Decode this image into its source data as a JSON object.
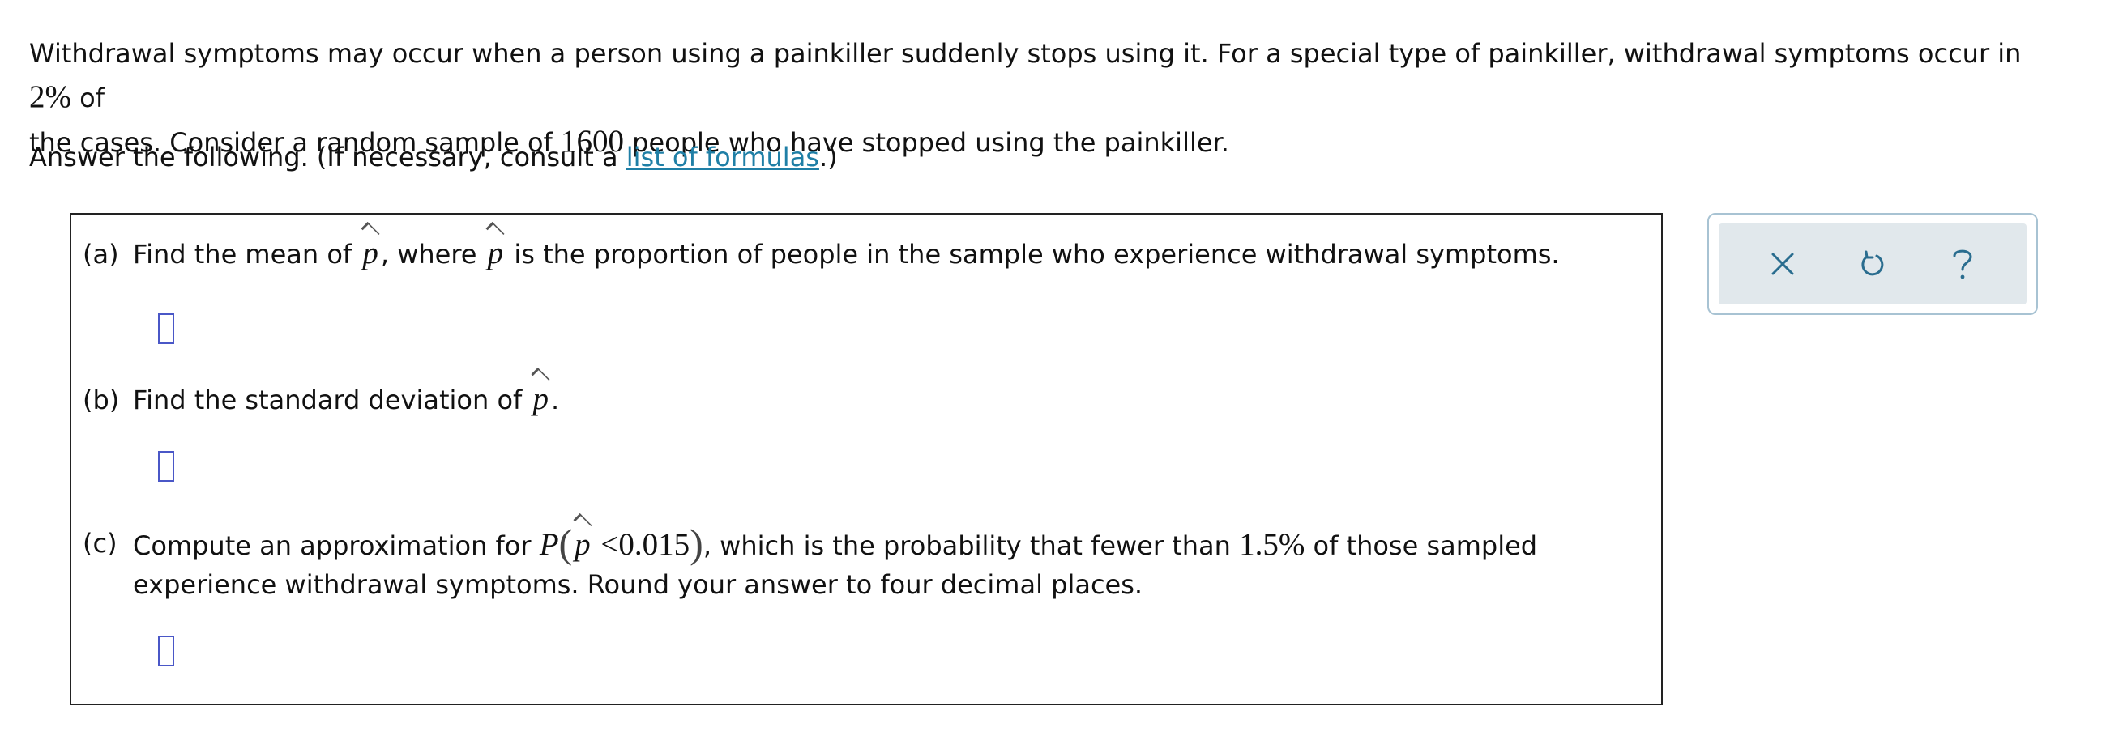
{
  "intro": {
    "text1": "Withdrawal symptoms may occur when a person using a painkiller suddenly stops using it. For a special type of painkiller, withdrawal symptoms occur in ",
    "percent": "2%",
    "text2": " of",
    "text3": "the cases. Consider a random sample of ",
    "sample_size": "1600",
    "text4": " people who have stopped using the painkiller."
  },
  "instructions": {
    "text_before": "Answer the following. (If necessary, consult a ",
    "link_text": "list of formulas",
    "text_after": ".)"
  },
  "parts": {
    "a": {
      "label": "(a)",
      "text1": "Find the mean of ",
      "symbol": "p",
      "text2": ", where ",
      "text3": " is the proportion of people in the sample who experience withdrawal symptoms."
    },
    "b": {
      "label": "(b)",
      "text1": "Find the standard deviation of ",
      "symbol": "p",
      "text2": "."
    },
    "c": {
      "label": "(c)",
      "text1": "Compute an approximation for ",
      "prob_P": "P",
      "open_paren": "(",
      "symbol": "p",
      "inequality": " <0.015",
      "close_paren": ")",
      "text2": ", which is the probability that fewer than ",
      "percent": "1.5%",
      "text3": " of those sampled",
      "text4": "experience withdrawal symptoms. Round your answer to four decimal places."
    }
  },
  "toolbar": {
    "clear_icon": "close-icon",
    "undo_icon": "undo-icon",
    "help_icon": "help-icon"
  },
  "colors": {
    "link": "#1f7fa6",
    "input_border": "#4a57c7",
    "toolbar_background": "#e1e8ec",
    "toolbar_border": "#a8c3d3",
    "icon_color": "#2a6d8f"
  }
}
